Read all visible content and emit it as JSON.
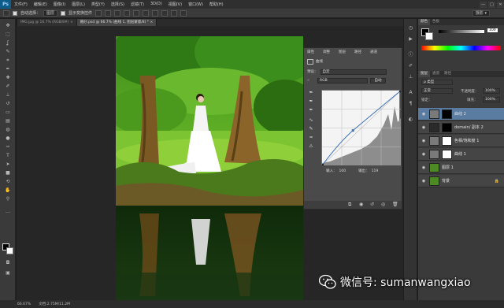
{
  "app": {
    "logo": "Ps"
  },
  "menu": [
    "文件(F)",
    "编辑(E)",
    "图像(I)",
    "图层(L)",
    "类型(Y)",
    "选择(S)",
    "滤镜(T)",
    "3D(D)",
    "视图(V)",
    "窗口(W)",
    "帮助(H)"
  ],
  "window_controls": [
    "—",
    "□",
    "✕"
  ],
  "options": {
    "auto_select_label": "自动选择：",
    "auto_select_value": "图层",
    "transform_label": "显示变换控件",
    "workspace": "摄影 ▾"
  },
  "tabs": [
    {
      "label": "IMG.jpg @ 16.7% (RGB/8#) ×",
      "active": false
    },
    {
      "label": "婚纱.psd @ 66.7% (曲线 1, 图层蒙版/8) * ×",
      "active": true
    }
  ],
  "properties": {
    "tab1": "属性",
    "tab2": "调整",
    "tab3": "图层",
    "tab4": "路径",
    "tab5": "通道",
    "header": "曲线",
    "preset_label": "预设：",
    "preset_value": "自定",
    "channel_value": "RGB",
    "auto_button": "自动",
    "input_label": "输入：",
    "input_value": "100",
    "output_label": "输出：",
    "output_value": "119"
  },
  "layers_panel": {
    "tabs": [
      "图层",
      "通道",
      "路径"
    ],
    "kind_label": "ρ 类型",
    "blend_mode": "正常",
    "opacity_label": "不透明度：",
    "opacity_value": "100%",
    "lock_label": "锁定：",
    "fill_label": "填充：",
    "fill_value": "100%",
    "layers": [
      {
        "name": "曲线 2",
        "selected": true
      },
      {
        "name": "domain/ 副本 2",
        "selected": false
      },
      {
        "name": "色相/饱和度 1",
        "selected": false
      },
      {
        "name": "曲线 1",
        "selected": false
      },
      {
        "name": "图层 1",
        "selected": false
      },
      {
        "name": "背景",
        "selected": false
      }
    ]
  },
  "color_panel": {
    "tab1": "颜色",
    "tab2": "色板",
    "value": "100"
  },
  "status": {
    "zoom": "66.67%",
    "doc": "文档:2.75M/11.2M"
  },
  "watermark": {
    "text": "微信号: sumanwangxiao"
  },
  "curve": {
    "input": 100,
    "output": 119
  }
}
